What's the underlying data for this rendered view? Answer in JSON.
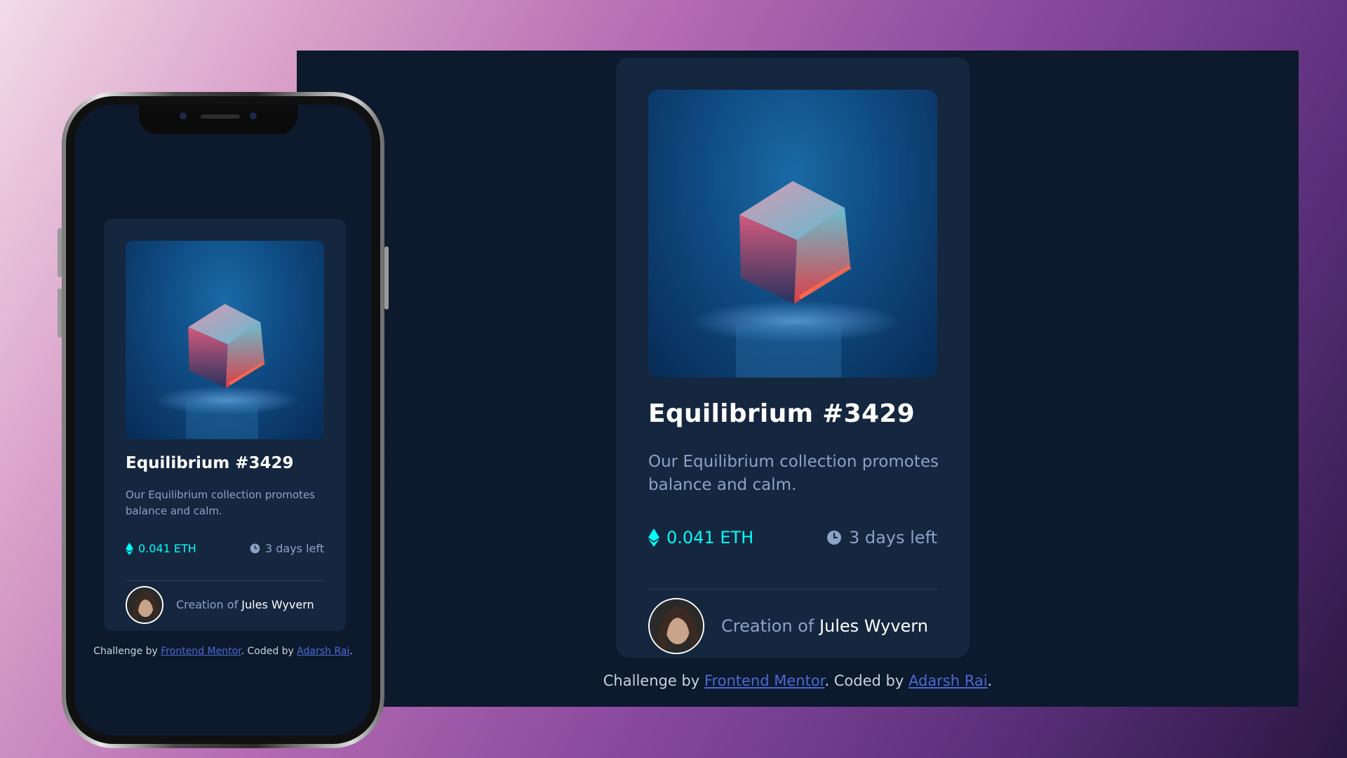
{
  "colors": {
    "background_start": "#f3dbe9",
    "background_end": "#2a1742",
    "page_bg": "#0d192c",
    "card_bg": "#15263f",
    "accent_cyan": "#00fff8",
    "soft_blue": "#8ba4c6",
    "link_blue": "#4a6bd6"
  },
  "card": {
    "title": "Equilibrium #3429",
    "description": "Our Equilibrium collection promotes balance and calm.",
    "price": "0.041 ETH",
    "time_left": "3 days left",
    "creation_prefix": "Creation of",
    "creator_name": "Jules Wyvern",
    "image_icon": "crystal-cube-image",
    "price_icon": "ethereum-icon",
    "time_icon": "clock-icon"
  },
  "footer": {
    "prefix": "Challenge by",
    "link1": "Frontend Mentor",
    "middle": ". Coded by",
    "link2": "Adarsh Rai",
    "suffix": "."
  }
}
